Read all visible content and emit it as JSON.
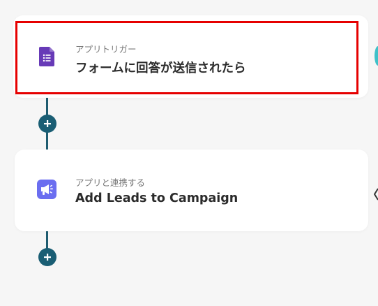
{
  "steps": [
    {
      "category": "アプリトリガー",
      "title": "フォームに回答が送信されたら",
      "icon": "google-forms-icon",
      "icon_color": "#673ab7",
      "selected": true
    },
    {
      "category": "アプリと連携する",
      "title": "Add Leads to Campaign",
      "icon": "megaphone-icon",
      "icon_color": "#6b6ef0",
      "selected": false
    }
  ],
  "colors": {
    "background": "#f6f6f6",
    "connector": "#1e5c70",
    "add_button": "#1a5e74",
    "highlight_border": "#e60000"
  },
  "add_buttons": [
    {
      "symbol": "+"
    },
    {
      "symbol": "+"
    }
  ]
}
